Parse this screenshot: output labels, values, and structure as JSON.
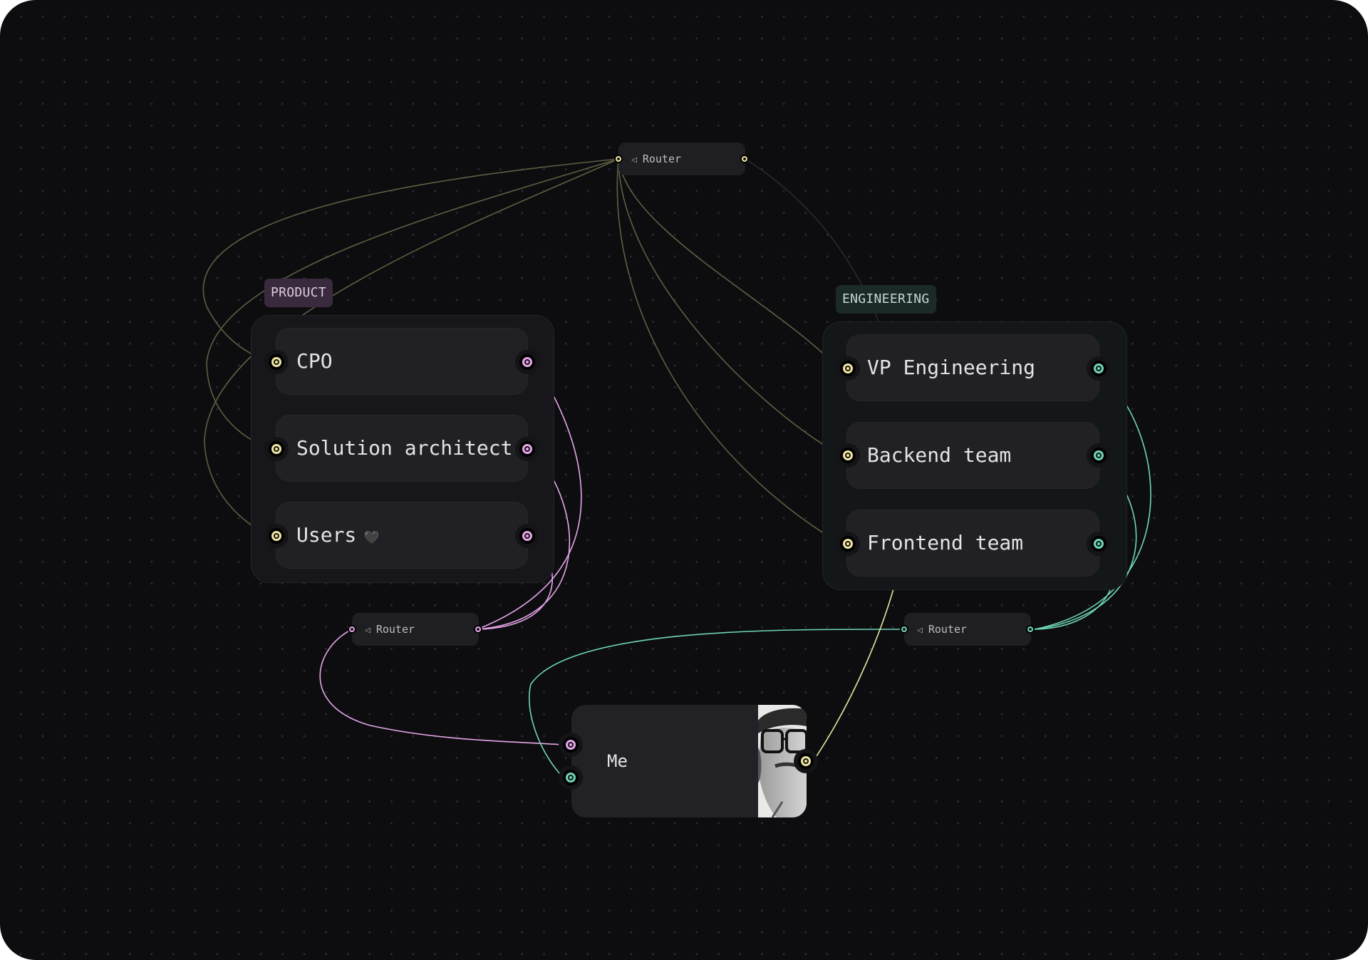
{
  "groups": {
    "product": {
      "label": "PRODUCT"
    },
    "engineering": {
      "label": "ENGINEERING"
    }
  },
  "nodes": {
    "cpo": "CPO",
    "solution_architect": "Solution architect",
    "users": "Users",
    "users_icon": "🖤",
    "vp_engineering": "VP Engineering",
    "backend_team": "Backend team",
    "frontend_team": "Frontend team",
    "me": "Me"
  },
  "routers": {
    "top": {
      "icon": "◁",
      "label": "Router"
    },
    "left": {
      "icon": "◁",
      "label": "Router"
    },
    "right": {
      "icon": "◁",
      "label": "Router"
    }
  },
  "icons": {
    "router": "router-icon",
    "heart": "heart-icon",
    "avatar": "avatar-photo"
  },
  "colors": {
    "background": "#0d0d10",
    "node": "#212125",
    "port_yellow": "#f1e7a2",
    "port_pink": "#e7a6ea",
    "port_green": "#6fd5b8",
    "wire_olive": "#5e5f43",
    "product_label_bg": "#3a2a3d",
    "engineering_label_bg": "#1b2a27"
  }
}
